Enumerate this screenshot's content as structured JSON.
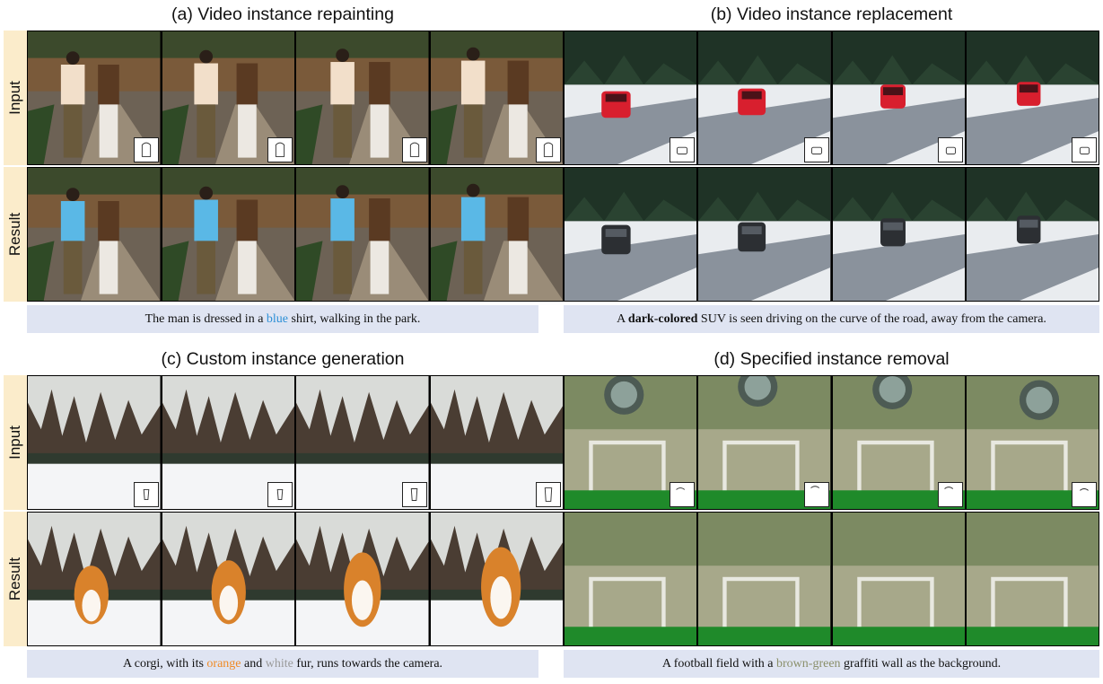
{
  "panels": {
    "a": {
      "title": "(a) Video instance repainting",
      "input_label": "Input",
      "result_label": "Result",
      "caption": {
        "pre": "The man is dressed in a ",
        "highlight": "blue",
        "post": " shirt, walking in the park."
      },
      "highlight_color": "#2b8fd6"
    },
    "b": {
      "title": "(b) Video instance replacement",
      "caption": {
        "pre": "A ",
        "highlight": "dark-colored",
        "post": " SUV is seen driving on the curve of the road, away from the camera."
      }
    },
    "c": {
      "title": "(c) Custom instance generation",
      "input_label": "Input",
      "result_label": "Result",
      "caption": {
        "pre": "A corgi, with its ",
        "highlight1": "orange",
        "mid": " and ",
        "highlight2": "white",
        "post": " fur, runs towards the camera."
      },
      "highlight1_color": "#f08a24",
      "highlight2_color": "#9a9a9a"
    },
    "d": {
      "title": "(d) Specified instance removal",
      "caption": {
        "pre": "A football field with a ",
        "highlight": "brown-green",
        "post": " graffiti wall as the background."
      },
      "highlight_color": "#8a8f6a"
    }
  },
  "colors": {
    "label_bg": "#fbeccb",
    "caption_bg": "#dfe4f2"
  }
}
